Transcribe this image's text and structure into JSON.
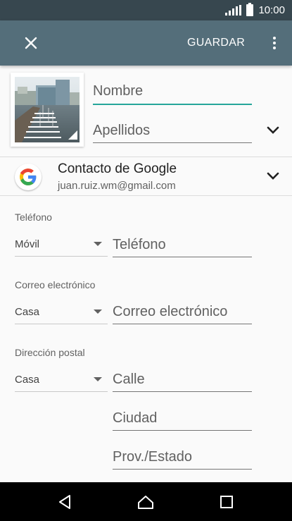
{
  "status_bar": {
    "time": "10:00"
  },
  "app_bar": {
    "save_label": "GUARDAR"
  },
  "name": {
    "first_placeholder": "Nombre",
    "last_placeholder": "Apellidos"
  },
  "account": {
    "title": "Contacto de Google",
    "email": "juan.ruiz.wm@gmail.com"
  },
  "phone": {
    "section_label": "Teléfono",
    "type": "Móvil",
    "placeholder": "Teléfono"
  },
  "email": {
    "section_label": "Correo electrónico",
    "type": "Casa",
    "placeholder": "Correo electrónico"
  },
  "address": {
    "section_label": "Dirección postal",
    "type": "Casa",
    "street_placeholder": "Calle",
    "city_placeholder": "Ciudad",
    "state_placeholder": "Prov./Estado"
  },
  "colors": {
    "app_bar": "#546e7a",
    "status_bar": "#37474f",
    "accent": "#26a69a"
  }
}
